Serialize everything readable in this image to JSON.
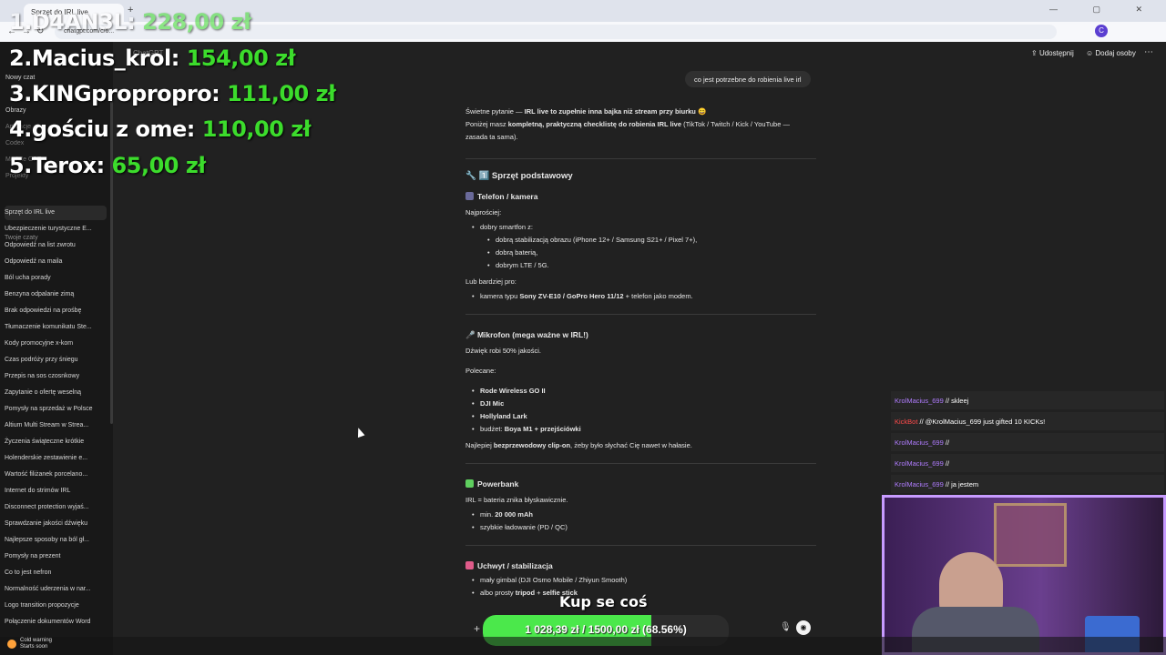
{
  "browser": {
    "tab_title": "Sprzęt do IRL live",
    "new_tab": "+",
    "url": "chatgpt.com/c/6...",
    "nav_back": "←",
    "nav_forward": "→",
    "nav_reload": "↻",
    "profile_initial": "C",
    "window_controls": "— ▢ ✕"
  },
  "leaderboard": [
    {
      "rank": "1.",
      "name": "D4AN3L",
      "amount": "228,00 zł"
    },
    {
      "rank": "2.",
      "name": "Macius_krol",
      "amount": "154,00 zł"
    },
    {
      "rank": "3.",
      "name": "KINGpropropro",
      "amount": "111,00 zł"
    },
    {
      "rank": "4.",
      "name": "gościu z ome",
      "amount": "110,00 zł"
    },
    {
      "rank": "5.",
      "name": "Terox",
      "amount": "65,00 zł"
    }
  ],
  "sidebar": {
    "top_items": [
      "Nowy czat",
      "Obrazy",
      "Aplikacje",
      "Codex",
      "Modele GPT",
      "Projekty"
    ],
    "section_title": "Twoje czaty",
    "chats": [
      "Sprzęt do IRL live",
      "Ubezpieczenie turystyczne E...",
      "Odpowiedź na list zwrotu",
      "Odpowiedź na maila",
      "Ból ucha porady",
      "Benzyna odpalanie zimą",
      "Brak odpowiedzi na prośbę",
      "Tłumaczenie komunikatu Ste...",
      "Kody promocyjne x-kom",
      "Czas podróży przy śniegu",
      "Przepis na sos czosnkowy",
      "Zapytanie o ofertę weselną",
      "Pomysły na sprzedaż w Polsce",
      "Altium Multi Stream w Strea...",
      "Życzenia świąteczne krótkie",
      "Holenderskie zestawienie e...",
      "Wartość filiżanek porcelano...",
      "Internet do strimów IRL",
      "Disconnect protection wyjaś...",
      "Sprawdzanie jakości dźwięku",
      "Najlepsze sposoby na ból gł...",
      "Pomysły na prezent",
      "Co to jest nefron",
      "Normalność uderzenia w nar...",
      "Logo transition propozycje",
      "Połączenie dokumentów Word"
    ]
  },
  "header": {
    "model": "ChatGPT",
    "share": "Udostępnij",
    "add_people": "Dodaj osoby",
    "more": "⋯"
  },
  "user_message": "co jest potrzebne do robienia live irl",
  "answer": {
    "intro_1a": "Świetne pytanie — ",
    "intro_1b": "IRL live to zupełnie inna bajka niż stream przy biurku",
    "intro_1c": " 😄",
    "intro_2a": "Poniżej masz ",
    "intro_2b": "kompletną, praktyczną checklistę do robienia IRL live",
    "intro_2c": " (TikTok / Twitch / Kick / YouTube —",
    "intro_3": "zasada ta sama).",
    "s1_title": "1️⃣ Sprzęt podstawowy",
    "phone_title": "Telefon / kamera",
    "simplest": "Najprościej:",
    "good_phone": "dobry smartfon z:",
    "stab": "dobrą stabilizacją obrazu (iPhone 12+ / Samsung S21+ / Pixel 7+),",
    "battery": "dobrą baterią,",
    "lte": "dobrym LTE / 5G.",
    "or_better": "Lub bardziej pro:",
    "cam_a": "kamera typu ",
    "cam_b": "Sony ZV-E10 / GoPro Hero 11/12",
    "cam_c": " + telefon jako modem.",
    "mic_title": "Mikrofon (mega ważne w IRL!)",
    "mic_note": "Dźwięk robi 50% jakości.",
    "recommended": "Polecane:",
    "mic1": "Rode Wireless GO II",
    "mic2": "DJI Mic",
    "mic3": "Hollyland Lark",
    "mic4a": "budżet: ",
    "mic4b": "Boya M1 + przejściówki",
    "best_a": "Najlepiej ",
    "best_b": "bezprzewodowy clip-on",
    "best_c": ", żeby było słychać Cię nawet w hałasie.",
    "pb_title": "Powerbank",
    "pb_note": "IRL = bateria znika błyskawicznie.",
    "pb1a": "min. ",
    "pb1b": "20 000 mAh",
    "pb2": "szybkie ładowanie (PD / QC)",
    "grip_title": "Uchwyt / stabilizacja",
    "grip1": "mały gimbal (DJI Osmo Mobile / Zhiyun Smooth)",
    "grip2a": "albo prosty ",
    "grip2b": "tripod",
    "grip2c": " + ",
    "grip2d": "selfie stick"
  },
  "composer": {
    "plus": "+",
    "mic": "🎙",
    "voice": "◉"
  },
  "goal": {
    "title": "Kup se coś",
    "current": "1 028,39 zł",
    "target": "1500,00 zł",
    "percent_text": "(68.56%)",
    "progress": 0.6856,
    "color": "#4be84b"
  },
  "stream_chat": [
    {
      "user": "KrolMacius_699",
      "msg": "skleej",
      "bot": false
    },
    {
      "user": "KickBot",
      "msg": "@KrolMacius_699 just gifted 10 KICKs!",
      "bot": true
    },
    {
      "user": "KrolMacius_699",
      "msg": "",
      "bot": false
    },
    {
      "user": "KrolMacius_699",
      "msg": "",
      "bot": false
    },
    {
      "user": "KrolMacius_699",
      "msg": "ja jestem",
      "bot": false
    }
  ],
  "weather": {
    "title": "Cold warning",
    "subtitle": "Starts soon"
  },
  "colors": {
    "accent_green": "#3cdc2c",
    "webcam_border": "#c79bff",
    "chat_user": "#b07cff"
  }
}
